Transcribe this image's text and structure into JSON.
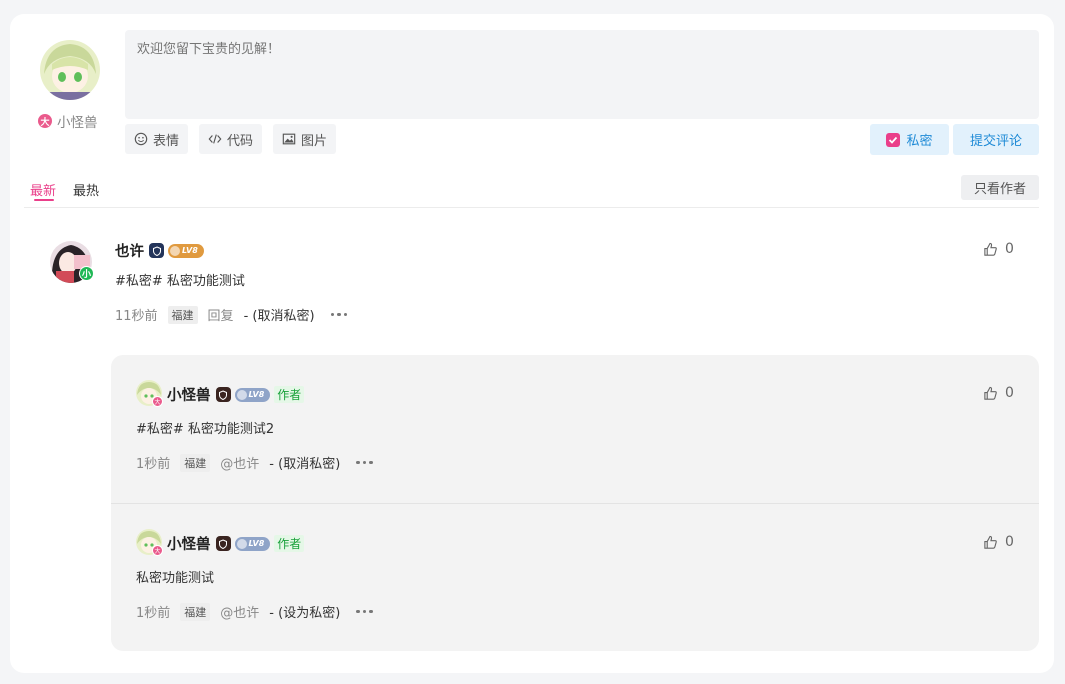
{
  "editor": {
    "placeholder": "欢迎您留下宝贵的见解！",
    "user_name": "小怪兽",
    "user_badge": "大",
    "tools": {
      "emoji": "表情",
      "code": "代码",
      "image": "图片"
    },
    "private_label": "私密",
    "submit_label": "提交评论"
  },
  "tabs": {
    "newest": "最新",
    "hottest": "最热",
    "author_only": "只看作者"
  },
  "comments": [
    {
      "name": "也许",
      "level": "LV8",
      "content": "#私密# 私密功能测试",
      "time": "11秒前",
      "location": "福建",
      "reply_label": "回复",
      "action": "- (取消私密)",
      "likes": "0",
      "avatar_badge": "小"
    }
  ],
  "replies": [
    {
      "name": "小怪兽",
      "level": "LV8",
      "author_tag": "作者",
      "content": "#私密# 私密功能测试2",
      "time": "1秒前",
      "location": "福建",
      "mention": "@也许",
      "action": "- (取消私密)",
      "likes": "0"
    },
    {
      "name": "小怪兽",
      "level": "LV8",
      "author_tag": "作者",
      "content": "私密功能测试",
      "time": "1秒前",
      "location": "福建",
      "mention": "@也许",
      "action": "- (设为私密)",
      "likes": "0"
    }
  ],
  "colors": {
    "accent_pink": "#ea3f8a",
    "accent_blue": "#1e8ad6",
    "author_green": "#19a13a"
  }
}
